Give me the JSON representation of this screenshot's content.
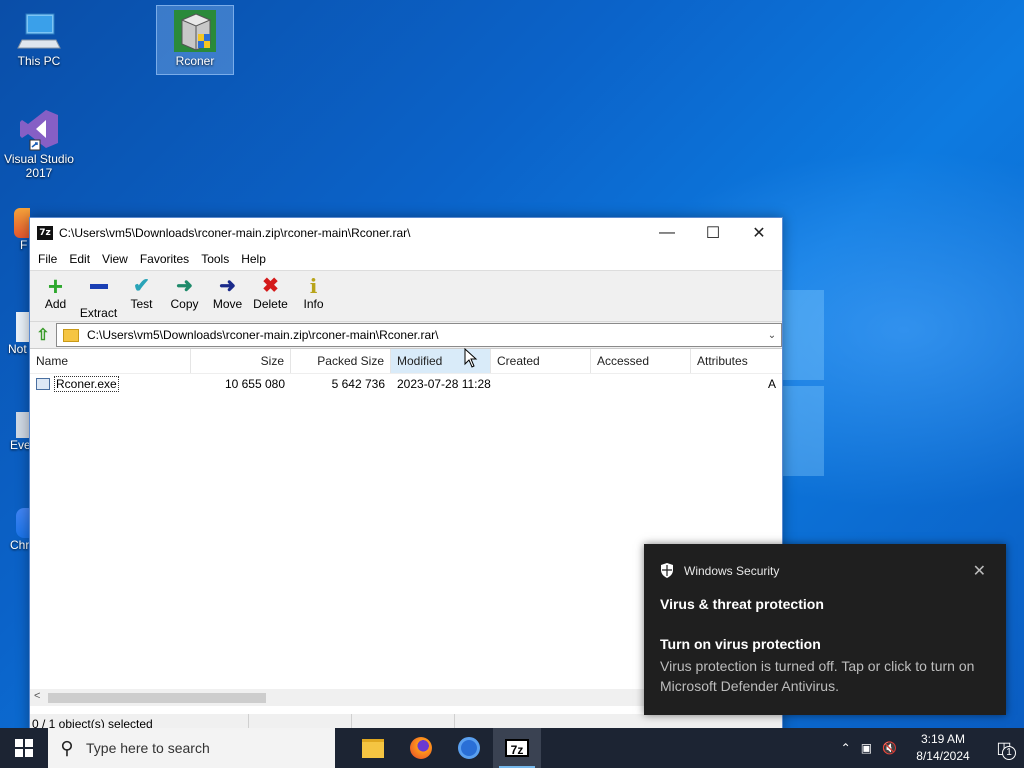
{
  "desktop": {
    "icons": [
      {
        "label": "This PC"
      },
      {
        "label": "Rconer"
      },
      {
        "label": "Visual Studio 2017"
      }
    ],
    "partial_labels": [
      "F",
      "Not",
      "Eve",
      "Chr"
    ]
  },
  "window": {
    "title": "C:\\Users\\vm5\\Downloads\\rconer-main.zip\\rconer-main\\Rconer.rar\\",
    "app_icon_text": "7z",
    "menu": [
      "File",
      "Edit",
      "View",
      "Favorites",
      "Tools",
      "Help"
    ],
    "toolbar": [
      {
        "label": "Add",
        "icon": "plus-icon"
      },
      {
        "label": "Extract",
        "icon": "minus-icon"
      },
      {
        "label": "Test",
        "icon": "check-icon"
      },
      {
        "label": "Copy",
        "icon": "copy-arrow-icon"
      },
      {
        "label": "Move",
        "icon": "move-arrow-icon"
      },
      {
        "label": "Delete",
        "icon": "x-icon"
      },
      {
        "label": "Info",
        "icon": "info-icon"
      }
    ],
    "address": "C:\\Users\\vm5\\Downloads\\rconer-main.zip\\rconer-main\\Rconer.rar\\",
    "columns": [
      "Name",
      "Size",
      "Packed Size",
      "Modified",
      "Created",
      "Accessed",
      "Attributes"
    ],
    "rows": [
      {
        "name": "Rconer.exe",
        "size": "10 655 080",
        "packed": "5 642 736",
        "modified": "2023-07-28 11:28",
        "created": "",
        "accessed": "",
        "attributes": "A"
      }
    ],
    "status": "0 / 1 object(s) selected"
  },
  "toast": {
    "app": "Windows Security",
    "title": "Virus & threat protection",
    "subtitle": "Turn on virus protection",
    "body": "Virus protection is turned off. Tap or click to turn on Microsoft Defender Antivirus."
  },
  "taskbar": {
    "search_placeholder": "Type here to search",
    "time": "3:19 AM",
    "date": "8/14/2024",
    "notification_count": "1"
  },
  "colors": {
    "desktop_blue": "#0b63c9",
    "taskbar": "#1c2433",
    "toast_bg": "#1f1f1f"
  }
}
